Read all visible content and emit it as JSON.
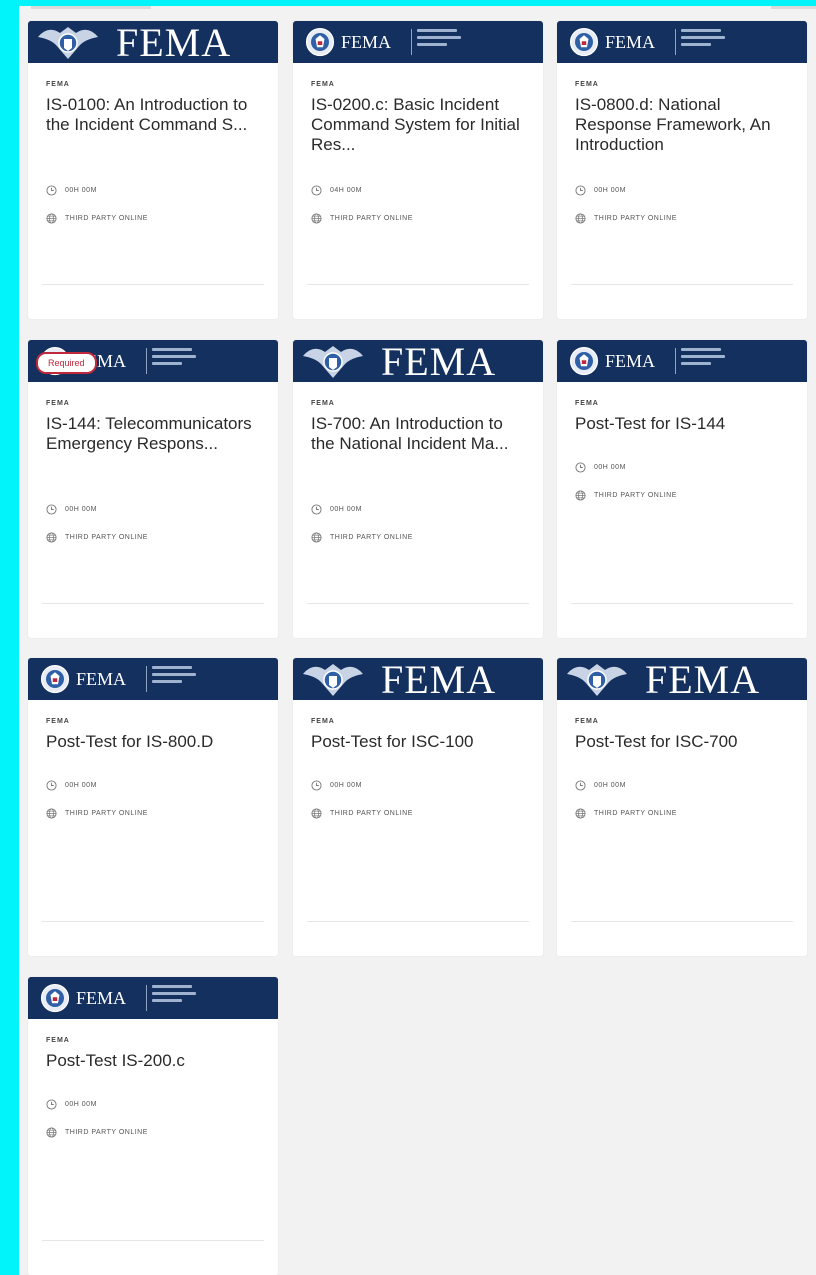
{
  "courses": [
    {
      "provider": "FEMA",
      "title": "IS-0100: An Introduction to the Incident Command S...",
      "duration": "00H 00M",
      "format": "THIRD PARTY ONLINE",
      "banner": "big",
      "required": ""
    },
    {
      "provider": "FEMA",
      "title": "IS-0200.c: Basic Incident Command System for Initial Res...",
      "duration": "04H 00M",
      "format": "THIRD PARTY ONLINE",
      "banner": "small",
      "required": ""
    },
    {
      "provider": "FEMA",
      "title": "IS-0800.d: National Response Framework, An Introduction",
      "duration": "00H 00M",
      "format": "THIRD PARTY ONLINE",
      "banner": "small",
      "required": ""
    },
    {
      "provider": "FEMA",
      "title": "IS-144: Telecommunicators Emergency Respons...",
      "duration": "00H 00M",
      "format": "THIRD PARTY ONLINE",
      "banner": "small",
      "required": "Required"
    },
    {
      "provider": "FEMA",
      "title": "IS-700: An Introduction to the National Incident Ma...",
      "duration": "00H 00M",
      "format": "THIRD PARTY ONLINE",
      "banner": "big",
      "required": ""
    },
    {
      "provider": "FEMA",
      "title": "Post-Test for IS-144",
      "duration": "00H 00M",
      "format": "THIRD PARTY ONLINE",
      "banner": "small",
      "required": ""
    },
    {
      "provider": "FEMA",
      "title": "Post-Test for IS-800.D",
      "duration": "00H 00M",
      "format": "THIRD PARTY ONLINE",
      "banner": "small",
      "required": ""
    },
    {
      "provider": "FEMA",
      "title": "Post-Test for ISC-100",
      "duration": "00H 00M",
      "format": "THIRD PARTY ONLINE",
      "banner": "big",
      "required": ""
    },
    {
      "provider": "FEMA",
      "title": "Post-Test for ISC-700",
      "duration": "00H 00M",
      "format": "THIRD PARTY ONLINE",
      "banner": "big",
      "required": ""
    },
    {
      "provider": "FEMA",
      "title": "Post-Test IS-200.c",
      "duration": "00H 00M",
      "format": "THIRD PARTY ONLINE",
      "banner": "small",
      "required": ""
    }
  ],
  "banner_text": "FEMA",
  "icons": {
    "duration": "clock-icon",
    "format": "globe-icon",
    "seal": "dhs-seal-icon"
  },
  "colors": {
    "banner": "#13305f",
    "frame": "#00f4fa",
    "required": "#c0283b"
  }
}
